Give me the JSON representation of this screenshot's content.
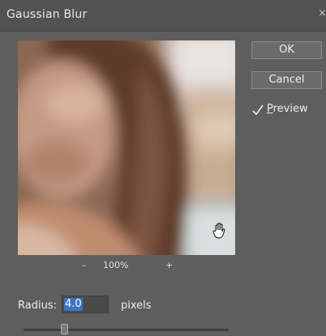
{
  "dialog": {
    "title": "Gaussian Blur",
    "close_glyph": "×",
    "close_icon": "close-icon"
  },
  "zoom": {
    "minus": "–",
    "percent": "100%",
    "plus": "+"
  },
  "buttons": {
    "ok": "OK",
    "cancel": "Cancel"
  },
  "preview_toggle": {
    "checked": true,
    "underlined_letter": "P",
    "rest": "review",
    "check_icon": "checkmark-icon"
  },
  "radius": {
    "label": "Radius:",
    "value": "4.0",
    "unit": "pixels",
    "slider_fraction": 0.2
  },
  "cursor": {
    "icon": "hand-cursor-icon"
  },
  "colors": {
    "dialog_bg": "#5e5e5e",
    "selection": "#3d73c6"
  }
}
